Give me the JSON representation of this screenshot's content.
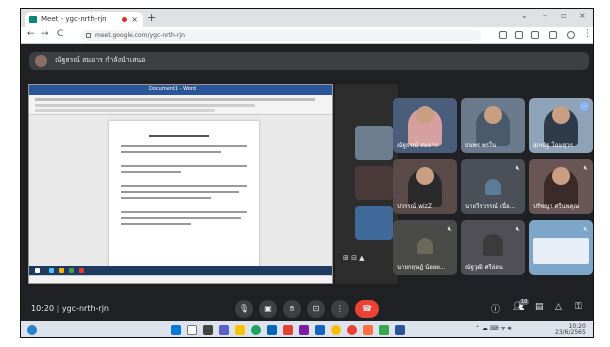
{
  "browser": {
    "tab_title": "Meet - ygc-nrth-rjn",
    "new_tab": "+",
    "url": "meet.google.com/ygc-nrth-rjn",
    "back": "←",
    "forward": "→",
    "reload": "C"
  },
  "banner": {
    "presenter_text": "ณัฐธรณ์ สมอาร กำลังนำเสนอ"
  },
  "presentation": {
    "doc_title": "Document1 - Word"
  },
  "participants": [
    {
      "name": "ณัฐธรณ์ สมอาร"
    },
    {
      "name": "ธนพร พรใน"
    },
    {
      "name": "สุภณัฐ โฉมสุวร"
    },
    {
      "name": "ปวรรณ์ wizZ"
    },
    {
      "name": "นายวีรวรรณ์ เนื่อ..."
    },
    {
      "name": "ปรัชญา ศรีนพคุณ"
    },
    {
      "name": "นายกฤษฎ์ น้อยผ..."
    },
    {
      "name": "ณัฐวุฒิ ศรีอ่อน"
    },
    {
      "name": ""
    }
  ],
  "meeting_bar": {
    "time": "10:20",
    "meeting_code": "ygc-nrth-rjn",
    "people_count": "10"
  },
  "taskbar": {
    "clock_time": "10:20",
    "clock_date": "23/6/2565"
  },
  "colors": {
    "meet_bg": "#202124",
    "end_call": "#ea4335",
    "word_blue": "#2b579a"
  }
}
